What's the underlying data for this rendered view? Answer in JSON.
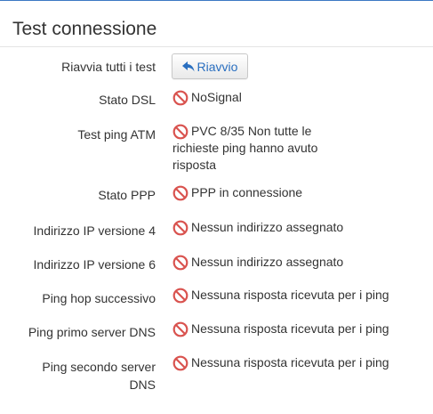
{
  "panel": {
    "title": "Test connessione"
  },
  "restart": {
    "label": "Riavvia tutti i test",
    "button_label": "Riavvio",
    "icon": "reply-icon",
    "accent_color": "#2a6fc0"
  },
  "status_icon": {
    "name": "ban-icon",
    "color": "#d9534f"
  },
  "rows": [
    {
      "label": "Stato DSL",
      "value": "NoSignal"
    },
    {
      "label": "Test ping ATM",
      "value": "PVC 8/35 Non tutte le richieste ping hanno avuto risposta"
    },
    {
      "label": "Stato PPP",
      "value": "PPP in connessione"
    },
    {
      "label": "Indirizzo IP versione 4",
      "value": "Nessun indirizzo assegnato"
    },
    {
      "label": "Indirizzo IP versione 6",
      "value": "Nessun indirizzo assegnato"
    },
    {
      "label": "Ping hop successivo",
      "value": "Nessuna risposta ricevuta per i ping"
    },
    {
      "label": "Ping primo server DNS",
      "value": "Nessuna risposta ricevuta per i ping"
    },
    {
      "label": "Ping secondo server DNS",
      "value": "Nessuna risposta ricevuta per i ping"
    }
  ]
}
